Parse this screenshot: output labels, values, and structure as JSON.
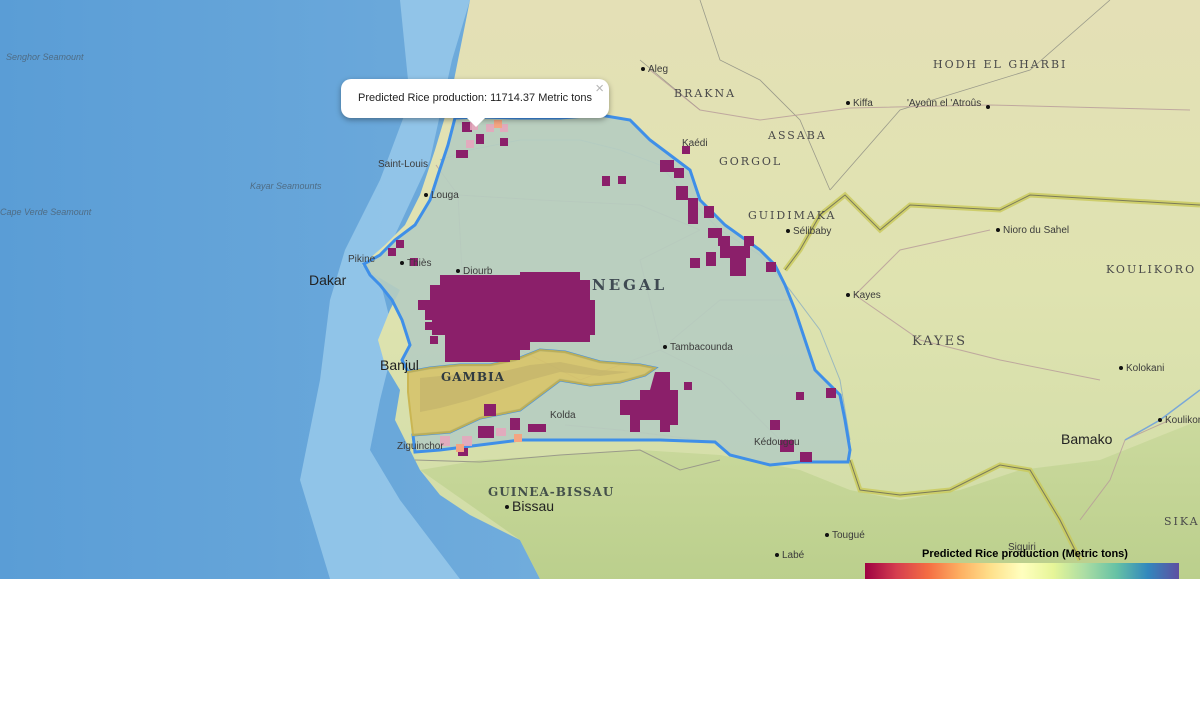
{
  "popup": {
    "text": "Predicted Rice production: 11714.37 Metric tons",
    "close_glyph": "×",
    "close_icon": "close-icon"
  },
  "legend": {
    "title": "Predicted Rice production (Metric tons)",
    "ramp_colors": [
      "#9e0142",
      "#d53e4f",
      "#f46d43",
      "#fdae61",
      "#fee08b",
      "#ffffbf",
      "#e6f598",
      "#abdda4",
      "#66c2a5",
      "#3288bd",
      "#5e4fa2"
    ]
  },
  "colors": {
    "ocean": "#5b9fd6",
    "land": "#dfe2b4",
    "senegal_fill": "#b7cdbf",
    "border_highlight": "#3f8fe8",
    "gambia_fill": "#d9c36a",
    "high_production": "#8b1f6a",
    "mid_production": "#e4a7bd"
  },
  "labels": {
    "countries": {
      "senegal_partial": "NEGAL",
      "gambia": "GAMBIA",
      "guinea_bissau": "GUINEA-BISSAU"
    },
    "regions": {
      "hodh_el_gharbi": "HODH EL GHARBI",
      "brakna": "BRAKNA",
      "assaba": "ASSABA",
      "gorgol": "GORGOL",
      "guidimaka": "GUIDIMAKA",
      "koulikoro": "KOULIKORO",
      "kayes_region": "KAYES",
      "sikasso_partial": "SIKAS"
    },
    "cities": {
      "aleg": "Aleg",
      "kiffa": "Kiffa",
      "ayoun": "'Ayoûn el 'Atroûs",
      "kaedi": "Kaédi",
      "selibaby": "Sélibaby",
      "nioro": "Nioro du Sahel",
      "kayes": "Kayes",
      "saint_louis": "Saint-Louis",
      "louga": "Louga",
      "pikine": "Pikine",
      "thies": "Thiès",
      "diourbel": "Diourb",
      "tambacounda": "Tambacounda",
      "kolda": "Kolda",
      "ziguinchor": "Ziguinchor",
      "kedougou": "Kédougou",
      "kolokani": "Kolokani",
      "koulikoro_city": "Koulikoro",
      "tougue": "Tougué",
      "labe": "Labé",
      "siguiri": "Siguiri"
    },
    "capitals": {
      "dakar": "Dakar",
      "banjul": "Banjul",
      "bissau": "Bissau",
      "bamako": "Bamako"
    },
    "seamounts": {
      "senghor": "Senghor Seamount",
      "kayar": "Kayar Seamounts",
      "cape_verde": "Cape Verde Seamount"
    }
  }
}
